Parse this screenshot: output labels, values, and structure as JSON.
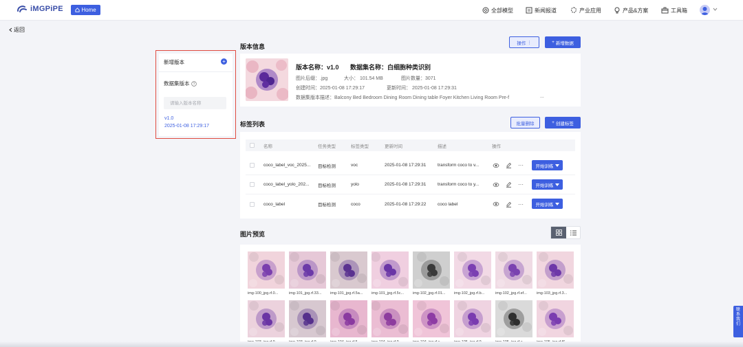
{
  "brand": {
    "name": "iMGPiPE",
    "home_label": "Home"
  },
  "topnav": [
    {
      "label": "全部模型",
      "icon": "model-icon"
    },
    {
      "label": "新闻报道",
      "icon": "news-icon"
    },
    {
      "label": "产业应用",
      "icon": "industry-icon"
    },
    {
      "label": "产品&方案",
      "icon": "bulb-icon"
    },
    {
      "label": "工具箱",
      "icon": "toolbox-icon"
    }
  ],
  "back_label": "返回",
  "version_panel": {
    "add_label": "新增版本",
    "dataset_label": "数据集版本",
    "input_placeholder": "请输入版本名称",
    "versions": [
      {
        "name": "v1.0",
        "time": "2025-01-08 17:29:17"
      }
    ]
  },
  "info": {
    "section_title": "版本信息",
    "ops_label": "操作",
    "add_data_label": "新增数据",
    "version_name": "版本名称：v1.0",
    "dataset_name": "数据集名称：白细胞种类识别",
    "suffix": "图片后缀：.jpg",
    "size": "大小：  101.54 MB",
    "count": "图片数量：3071",
    "created": "创建时间：2025-01-08 17:29:17",
    "updated": "更新时间：  2025-01-08 17:29:31",
    "description": "数据集版本描述：Balcony Bed Bedroom Dining Room Dining table Foyer Kitchen Living Room Pre-f",
    "ellipsis": "..."
  },
  "tags": {
    "section_title": "标签列表",
    "batch_delete_label": "批量删除",
    "create_label": "创建标签",
    "columns": [
      "名称",
      "任务类型",
      "标签类型",
      "更新时间",
      "描述",
      "操作"
    ],
    "rows": [
      {
        "name": "coco_label_voc_2025...",
        "task": "目标检测",
        "type": "voc",
        "updated": "2025-01-08 17:29:31",
        "desc": "transform coco to v..."
      },
      {
        "name": "coco_label_yolo_202...",
        "task": "目标检测",
        "type": "yolo",
        "updated": "2025-01-08 17:29:31",
        "desc": "transform coco to y..."
      },
      {
        "name": "coco_label",
        "task": "目标检测",
        "type": "coco",
        "updated": "2025-01-08 17:29:22",
        "desc": "coco label"
      }
    ],
    "train_label": "开始训练"
  },
  "preview": {
    "section_title": "图片预览",
    "images": [
      {
        "caption": "img-100_jpg.rf.0...",
        "cell": "#7a3fae",
        "bg": "#f1d4dc"
      },
      {
        "caption": "img-101_jpg.rf.33...",
        "cell": "#6b3aa8",
        "bg": "#e6c8d7"
      },
      {
        "caption": "img-101_jpg.rf.5a...",
        "cell": "#5a3290",
        "bg": "#d9c9cf"
      },
      {
        "caption": "img-101_jpg.rf.5c...",
        "cell": "#6a36a6",
        "bg": "#f0cfe0"
      },
      {
        "caption": "img-102_jpg.rf.01...",
        "cell": "#3a3a3a",
        "bg": "#cfcfcf"
      },
      {
        "caption": "img-102_jpg.rf.b...",
        "cell": "#7b3fb2",
        "bg": "#f2d9e5"
      },
      {
        "caption": "img-102_jpg.rf.ef...",
        "cell": "#7a42b0",
        "bg": "#f0dbe4"
      },
      {
        "caption": "img-103_jpg.rf.3...",
        "cell": "#6d38a8",
        "bg": "#f1d6df"
      },
      {
        "caption": "img-103_jpg.rf.9...",
        "cell": "#6a35a4",
        "bg": "#ecd2dd"
      },
      {
        "caption": "img-103_jpg.rf.9...",
        "cell": "#55308c",
        "bg": "#d7c8d0"
      },
      {
        "caption": "img-104_jpg.rf.5...",
        "cell": "#8a3aa0",
        "bg": "#e8b7cf"
      },
      {
        "caption": "img-104_jpg.rf.9...",
        "cell": "#8d3c9e",
        "bg": "#ebbdd3"
      },
      {
        "caption": "img-104_jpg.rf.c...",
        "cell": "#8e3ca4",
        "bg": "#f0c4d8"
      },
      {
        "caption": "img-105_jpg.rf.9...",
        "cell": "#7a3cb0",
        "bg": "#efd3e1"
      },
      {
        "caption": "img-105_jpg.rf.a...",
        "cell": "#2f2f2f",
        "bg": "#dadada"
      },
      {
        "caption": "img-105_jpg.rf.f6...",
        "cell": "#7a3db0",
        "bg": "#f1d5e0"
      }
    ]
  },
  "contact_label": "联系我们",
  "colors": {
    "primary": "#3d5fe0",
    "highlight_border": "#e04a3f"
  }
}
